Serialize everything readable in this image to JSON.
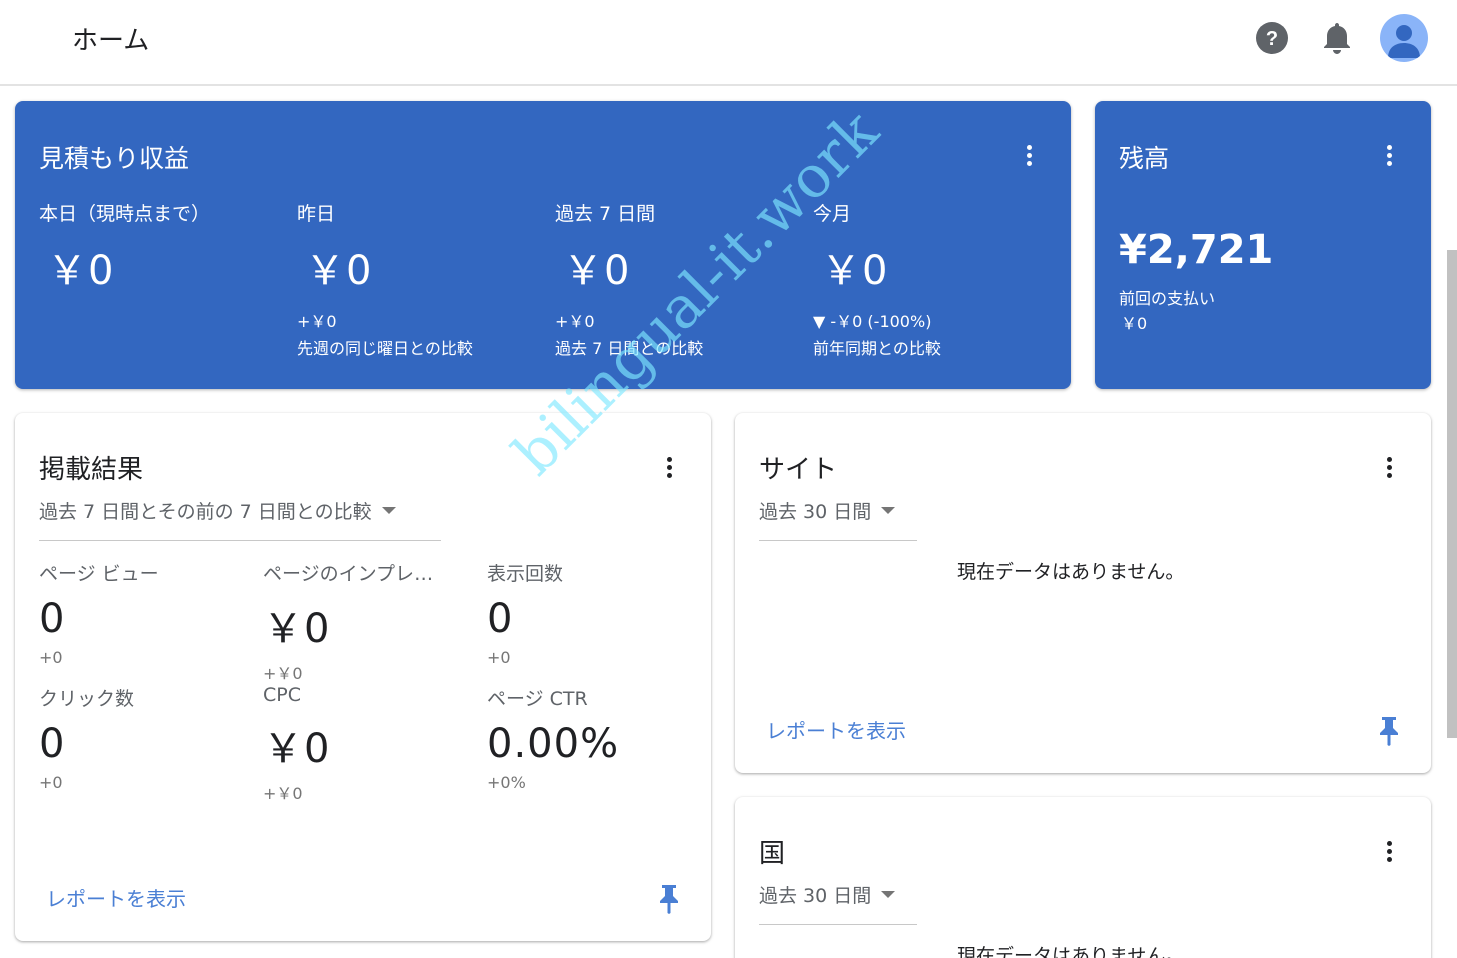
{
  "header": {
    "title": "ホーム",
    "help_icon": "help-circle-icon",
    "notifications_icon": "bell-icon",
    "avatar_icon": "account-avatar-icon"
  },
  "estimated_earnings": {
    "title": "見積もり収益",
    "metrics": [
      {
        "label": "本日（現時点まで）",
        "value": "￥0",
        "delta": "",
        "comparison": ""
      },
      {
        "label": "昨日",
        "value": "￥0",
        "delta": "+￥0",
        "comparison": "先週の同じ曜日との比較"
      },
      {
        "label": "過去 7 日間",
        "value": "￥0",
        "delta": "+￥0",
        "comparison": "過去 7 日間との比較"
      },
      {
        "label": "今月",
        "value": "￥0",
        "delta": "▼ -￥0 (-100%)",
        "comparison": "前年同期との比較"
      }
    ]
  },
  "balance": {
    "title": "残高",
    "value": "¥2,721",
    "last_payment_label": "前回の支払い",
    "last_payment_value": "￥0"
  },
  "performance": {
    "title": "掲載結果",
    "range": "過去 7 日間とその前の 7 日間との比較",
    "metrics": [
      {
        "label": "ページ ビュー",
        "value": "0",
        "delta": "+0"
      },
      {
        "label": "ページのインプレッション収益",
        "value": "￥0",
        "delta": "+￥0"
      },
      {
        "label": "表示回数",
        "value": "0",
        "delta": "+0"
      },
      {
        "label": "クリック数",
        "value": "0",
        "delta": "+0"
      },
      {
        "label": "CPC",
        "value": "￥0",
        "delta": "+￥0"
      },
      {
        "label": "ページ CTR",
        "value": "0.00%",
        "delta": "+0%"
      }
    ],
    "report_link": "レポートを表示"
  },
  "sites": {
    "title": "サイト",
    "range": "過去 30 日間",
    "empty": "現在データはありません。",
    "report_link": "レポートを表示"
  },
  "countries": {
    "title": "国",
    "range": "過去 30 日間",
    "empty": "現在データはありません。"
  },
  "watermark": "bilingual-it.work",
  "colors": {
    "primary_blue": "#3367c0",
    "link_blue": "#4a7fd4",
    "watermark": "#80e8ff"
  }
}
